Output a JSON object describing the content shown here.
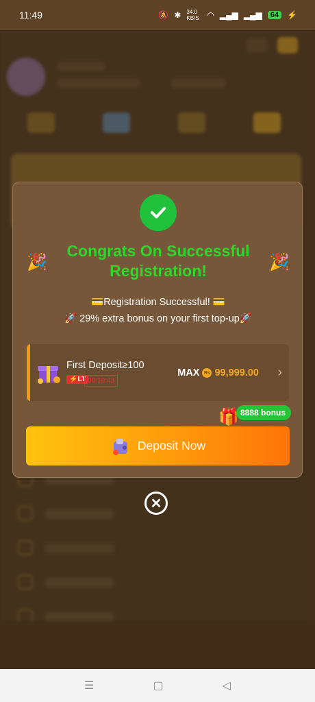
{
  "status": {
    "time": "11:49",
    "net_speed": "34.0 KB/S",
    "battery": "64"
  },
  "modal": {
    "title": "Congrats On Successful Registration!",
    "line1": "💳Registration Successful! 💳",
    "line2": "🚀 29% extra bonus on your first top-up🚀",
    "deposit_card": {
      "title": "First Deposit≥100",
      "badge": "LT",
      "timer": "00:10:43",
      "max_label": "MAX",
      "currency_symbol": "Rs",
      "max_amount": "99,999.00"
    },
    "bonus_tag": "8888 bonus",
    "deposit_button": "Deposit Now"
  },
  "colors": {
    "accent_green": "#2fd62a",
    "button_start": "#ffc20e",
    "button_end": "#ff7408",
    "timer_red": "#e0322c"
  }
}
